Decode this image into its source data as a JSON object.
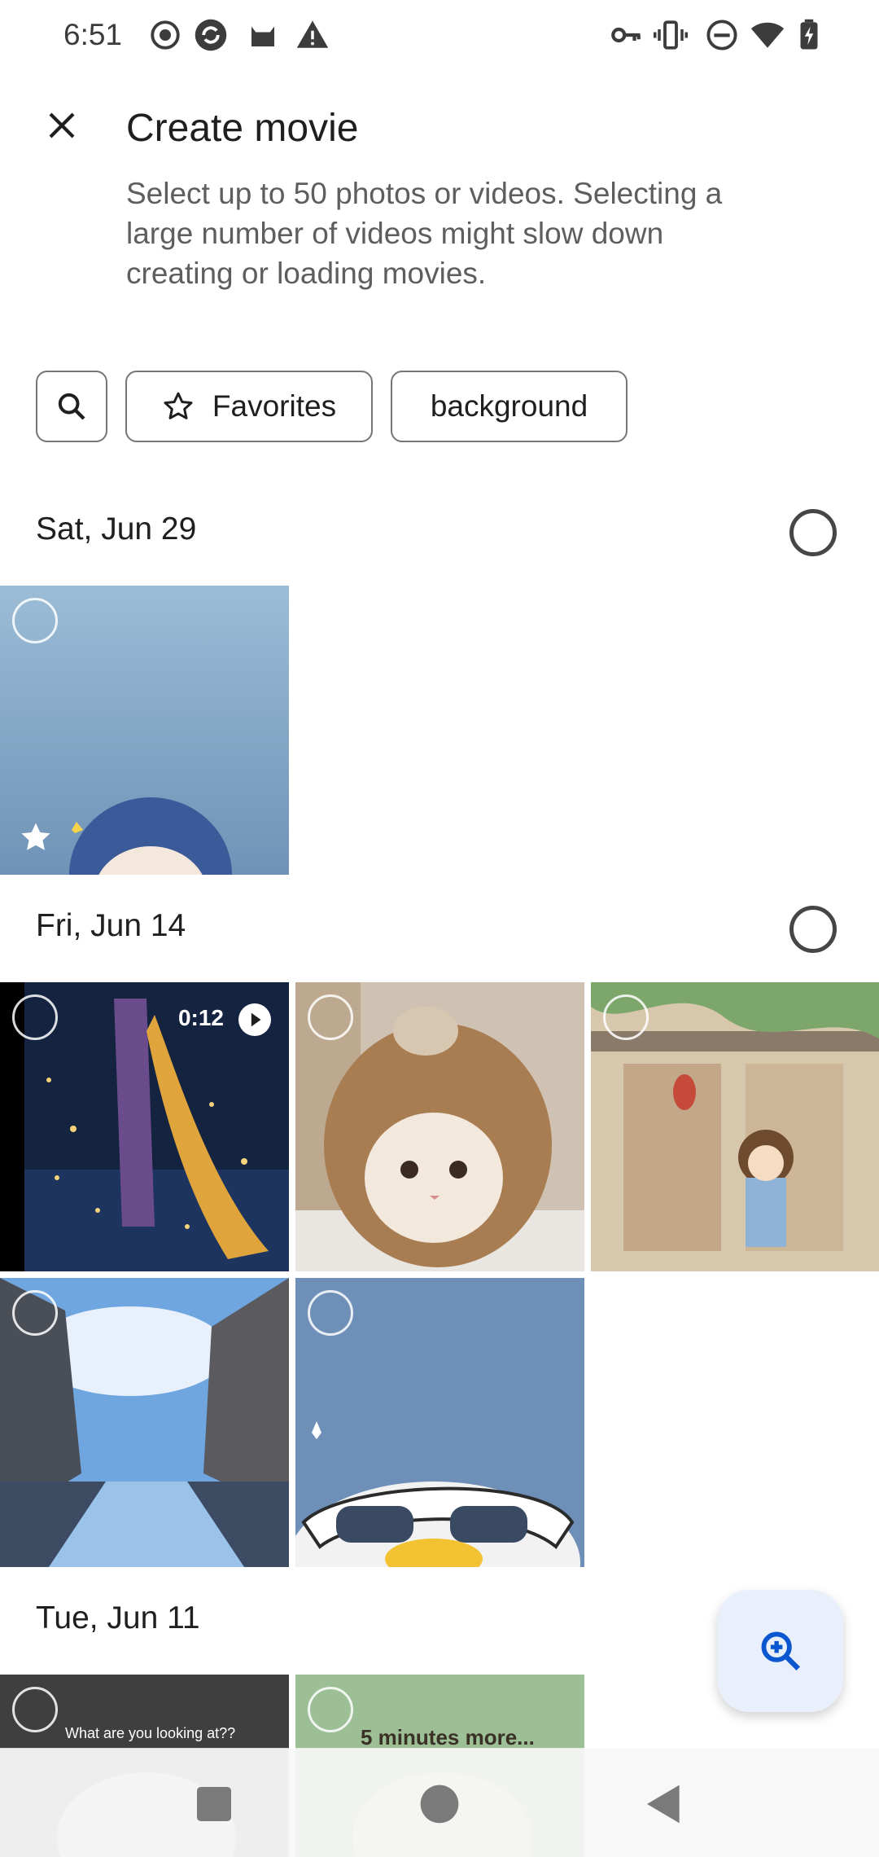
{
  "status_bar": {
    "time": "6:51",
    "icons": [
      "record-icon",
      "sync-icon",
      "cat-icon",
      "warning-icon",
      "vpn-key-icon",
      "vibrate-icon",
      "do-not-disturb-icon",
      "wifi-icon",
      "battery-charging-icon"
    ]
  },
  "header": {
    "title": "Create movie",
    "subtitle": "Select up to 50 photos or videos. Selecting a large number of videos might slow down creating or loading movies."
  },
  "chips": {
    "favorites_label": "Favorites",
    "background_label": "background"
  },
  "sections": [
    {
      "date": "Sat, Jun 29"
    },
    {
      "date": "Fri, Jun 14"
    },
    {
      "date": "Tue, Jun 11"
    }
  ],
  "tiles": {
    "video_duration": "0:12",
    "caption_1": "What are you looking at??",
    "caption_2": "5 minutes more..."
  },
  "colors": {
    "accent": "#0b57d0",
    "fab_bg": "#eaf0fb",
    "outline": "#747775"
  }
}
